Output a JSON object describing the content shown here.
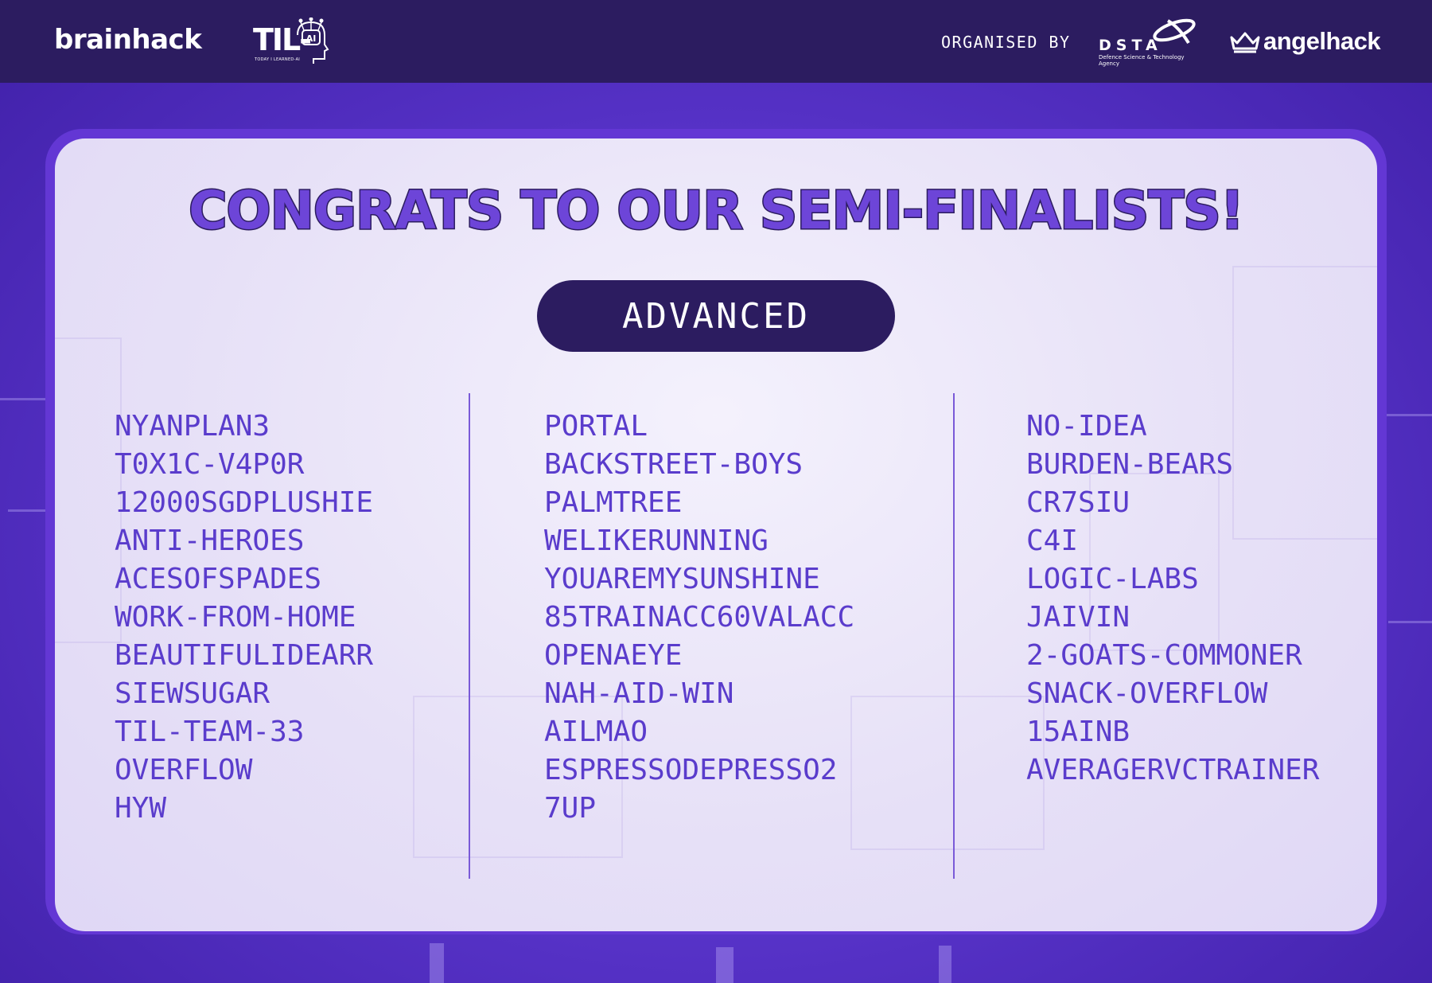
{
  "header": {
    "brand_logo": "brainhack",
    "til_logo": "TIL-",
    "til_badge": "AI",
    "til_tagline": "TODAY I LEARNED-AI",
    "organised_label": "ORGANISED BY",
    "dsta_logo": "DSTA",
    "dsta_tagline": "Defence Science & Technology Agency",
    "angelhack_logo": "angelhack"
  },
  "title": "CONGRATS TO OUR SEMI-FINALISTS!",
  "category": "ADVANCED",
  "colors": {
    "header_bg": "#2c1c60",
    "accent": "#6337d4",
    "team_text": "#5a3ccc"
  },
  "columns": [
    [
      "NYANPLAN3",
      "T0X1C-V4P0R",
      "12000SGDPLUSHIE",
      "ANTI-HEROES",
      "ACESOFSPADES",
      "WORK-FROM-HOME",
      "BEAUTIFULIDEARR",
      "SIEWSUGAR",
      "TIL-TEAM-33",
      "OVERFLOW",
      "HYW"
    ],
    [
      "PORTAL",
      "BACKSTREET-BOYS",
      "PALMTREE",
      "WELIKERUNNING",
      "YOUAREMYSUNSHINE",
      "85TRAINACC60VALACC",
      "OPENAEYE",
      "NAH-AID-WIN",
      "AILMAO",
      "ESPRESSODEPRESSO2",
      "7UP"
    ],
    [
      "NO-IDEA",
      "BURDEN-BEARS",
      "CR7SIU",
      "C4I",
      "LOGIC-LABS",
      "JAIVIN",
      "2-GOATS-COMMONER",
      "SNACK-OVERFLOW",
      "15AINB",
      "AVERAGERVCTRAINER"
    ]
  ]
}
